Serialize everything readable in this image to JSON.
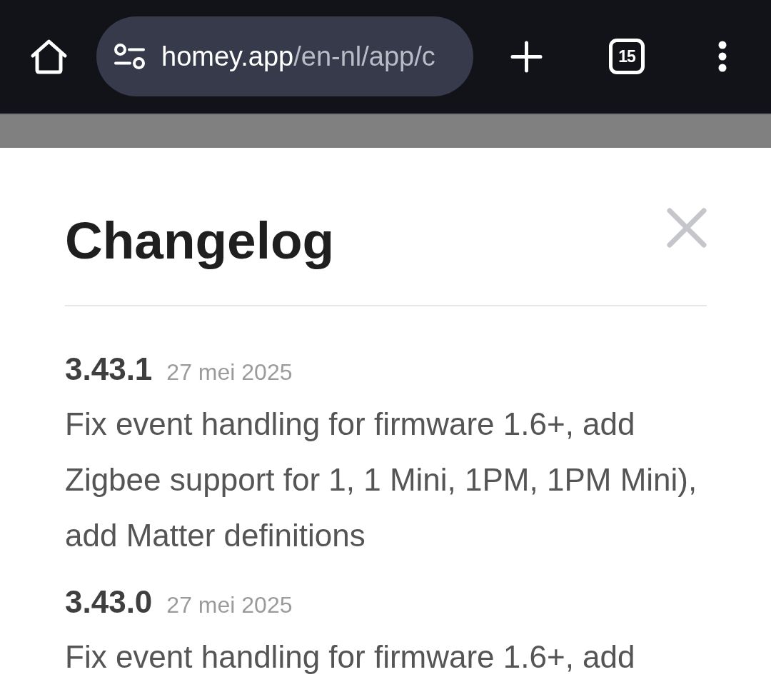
{
  "browser": {
    "url": "homey.app/en-nl/app/c",
    "tab_count": "15"
  },
  "dialog": {
    "title": "Changelog",
    "entries": [
      {
        "version": "3.43.1",
        "date": "27 mei 2025",
        "notes": "Fix event handling for firmware 1.6+, add Zigbee support for 1, 1 Mini, 1PM, 1PM Mini), add Matter definitions"
      },
      {
        "version": "3.43.0",
        "date": "27 mei 2025",
        "notes": "Fix event handling for firmware 1.6+, add"
      }
    ]
  }
}
